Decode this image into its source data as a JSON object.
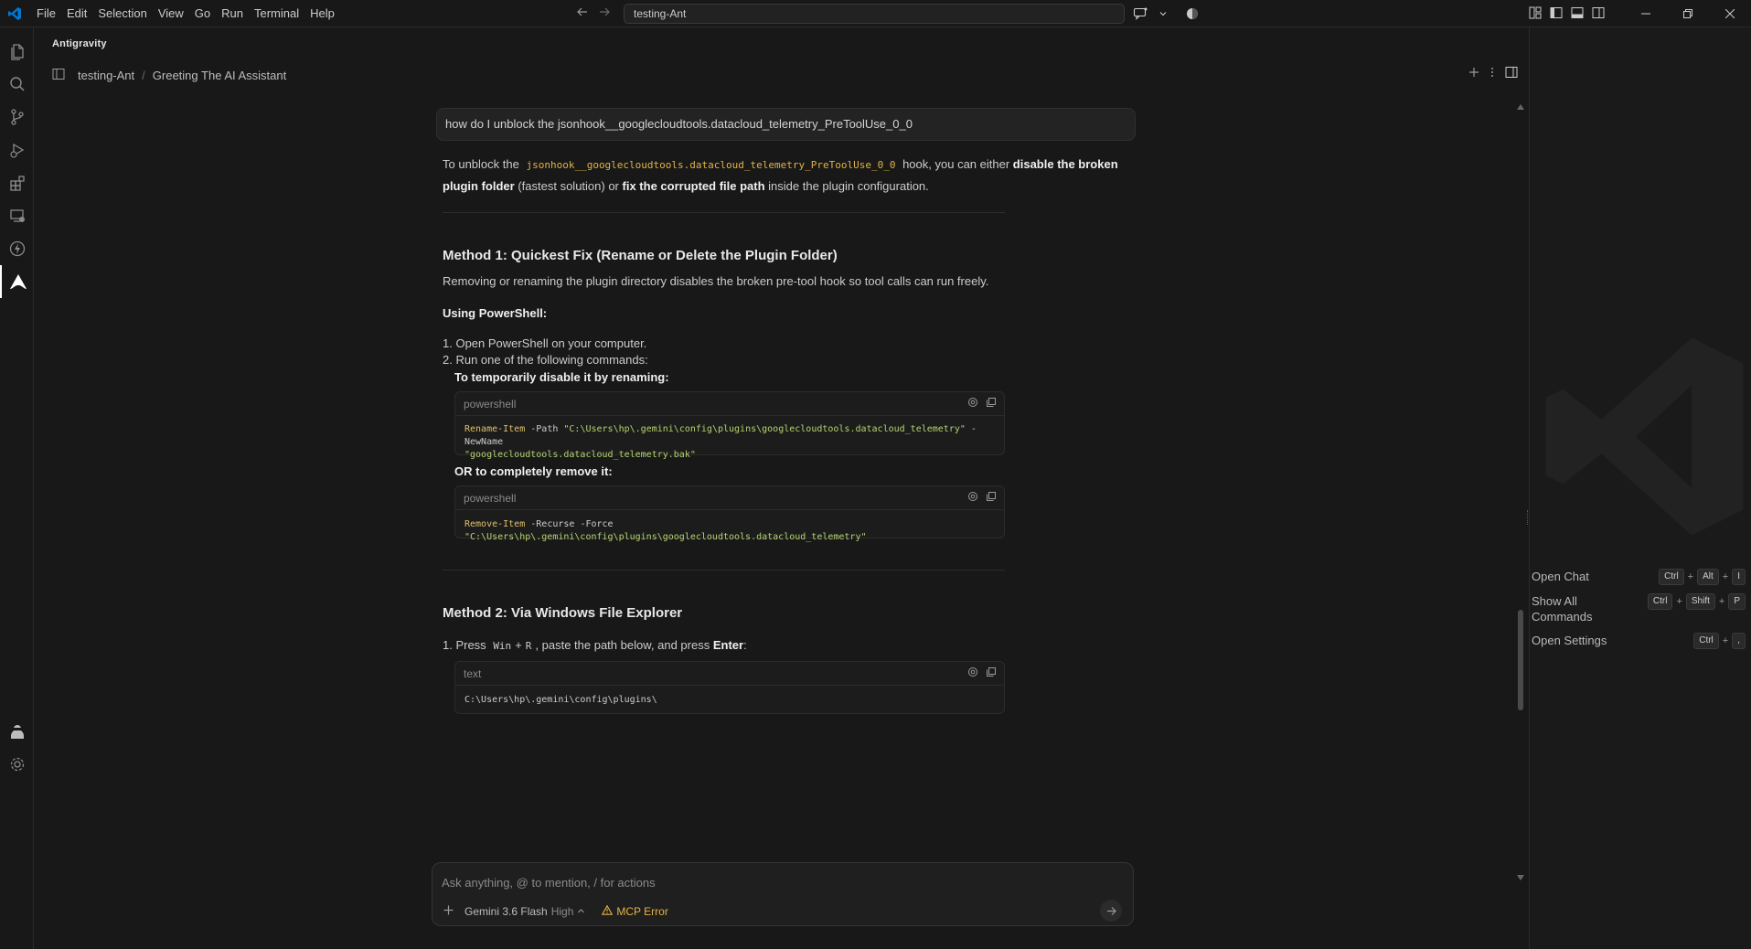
{
  "titlebar": {
    "menu": [
      "File",
      "Edit",
      "Selection",
      "View",
      "Go",
      "Run",
      "Terminal",
      "Help"
    ],
    "command_center": "testing-Ant"
  },
  "panel": {
    "title": "Antigravity",
    "breadcrumb": [
      "testing-Ant",
      "Greeting The AI Assistant"
    ]
  },
  "conversation": {
    "user_message": "how do I unblock the jsonhook__googlecloudtools.datacloud_telemetry_PreToolUse_0_0",
    "intro": {
      "t1": "To unblock the",
      "code": "jsonhook__googlecloudtools.datacloud_telemetry_PreToolUse_0_0",
      "t2": "hook, you can either",
      "b1": "disable the broken plugin folder",
      "t3": "(fastest solution) or",
      "b2": "fix the corrupted file path",
      "t4": "inside the plugin configuration."
    },
    "method1": {
      "heading": "Method 1: Quickest Fix (Rename or Delete the Plugin Folder)",
      "desc": "Removing or renaming the plugin directory disables the broken pre-tool hook so tool calls can run freely.",
      "using": "Using PowerShell:",
      "step1": "1. Open PowerShell on your computer.",
      "step2": "2. Run one of the following commands:",
      "sub1": "To temporarily disable it by renaming:",
      "code1": {
        "lang": "powershell",
        "cmd": "Rename-Item",
        "p1": " -Path ",
        "s1": "\"C:\\Users\\hp\\.gemini\\config\\plugins\\googlecloudtools.datacloud_telemetry\"",
        "p2": " -NewName",
        "s2": "\"googlecloudtools.datacloud_telemetry.bak\""
      },
      "sub2": "OR to completely remove it:",
      "code2": {
        "lang": "powershell",
        "cmd": "Remove-Item",
        "p1": " -Recurse -Force ",
        "s1": "\"C:\\Users\\hp\\.gemini\\config\\plugins\\googlecloudtools.datacloud_telemetry\""
      }
    },
    "method2": {
      "heading": "Method 2: Via Windows File Explorer",
      "step1_a": "1. Press",
      "key1": "Win",
      "plus": "+",
      "key2": "R",
      "step1_b": ", paste the path below, and press",
      "step1_enter": "Enter",
      "step1_c": ":",
      "code3": {
        "lang": "text",
        "body": "C:\\Users\\hp\\.gemini\\config\\plugins\\"
      }
    }
  },
  "input": {
    "placeholder": "Ask anything, @ to mention, / for actions",
    "model": "Gemini 3.6 Flash",
    "mode": "High",
    "mcp_status": "MCP Error"
  },
  "shortcuts": [
    {
      "label": "Open Chat",
      "keys": [
        "Ctrl",
        "Alt",
        "I"
      ]
    },
    {
      "label": "Show All Commands",
      "keys": [
        "Ctrl",
        "Shift",
        "P"
      ]
    },
    {
      "label": "Open Settings",
      "keys": [
        "Ctrl",
        ","
      ]
    }
  ],
  "colors": {
    "background": "#181818",
    "code_command": "#dcc26c",
    "code_string": "#b5d36f",
    "warning": "#e3b341",
    "vscode_blue": "#0078d4"
  }
}
